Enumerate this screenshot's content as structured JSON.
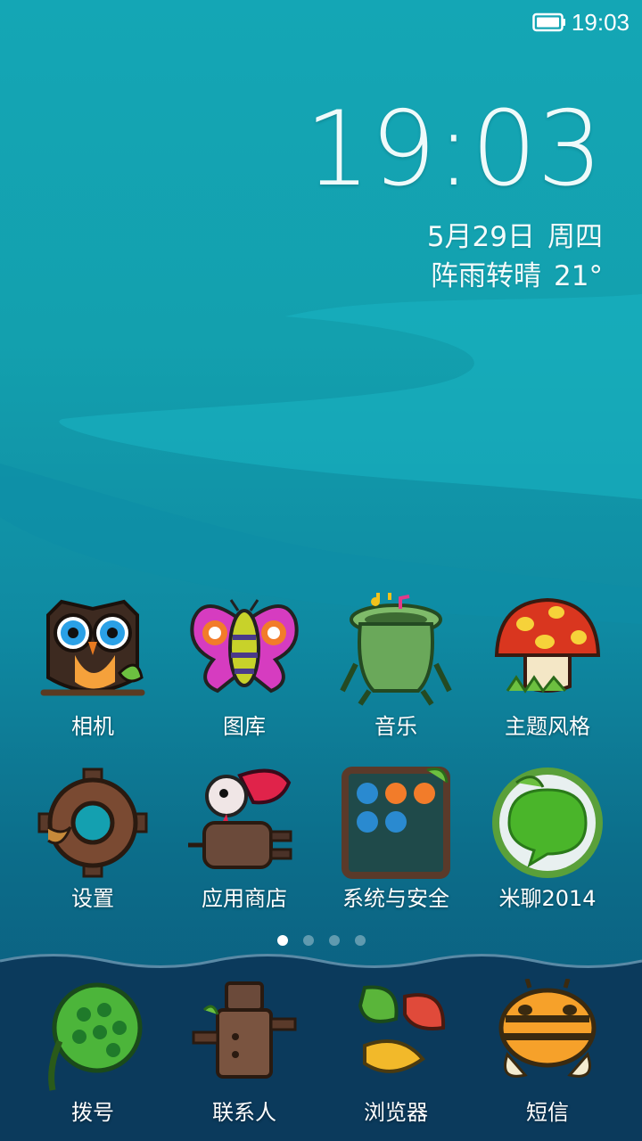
{
  "status_bar": {
    "time": "19:03",
    "battery_icon": "battery-icon"
  },
  "clock": {
    "time": "19:03",
    "date": "5月29日",
    "weekday": "周四",
    "weather": "阵雨转晴",
    "temperature": "21°"
  },
  "apps_row1": [
    {
      "label": "相机",
      "icon": "owl-camera-icon"
    },
    {
      "label": "图库",
      "icon": "butterfly-gallery-icon"
    },
    {
      "label": "音乐",
      "icon": "frog-music-icon"
    },
    {
      "label": "主题风格",
      "icon": "mushroom-theme-icon"
    }
  ],
  "apps_row2": [
    {
      "label": "设置",
      "icon": "gear-settings-icon"
    },
    {
      "label": "应用商店",
      "icon": "bird-plug-store-icon"
    },
    {
      "label": "系统与安全",
      "icon": "folder-system-icon"
    },
    {
      "label": "米聊2014",
      "icon": "miliao-icon"
    }
  ],
  "dock": [
    {
      "label": "拨号",
      "icon": "lotus-dialer-icon"
    },
    {
      "label": "联系人",
      "icon": "robot-contacts-icon"
    },
    {
      "label": "浏览器",
      "icon": "leaves-browser-icon"
    },
    {
      "label": "短信",
      "icon": "bee-sms-icon"
    }
  ],
  "page_indicator": {
    "pages": 4,
    "current": 1
  },
  "colors": {
    "background_top": "#14a6b5",
    "background_bottom": "#0a5478",
    "dock": "#0a3a5a"
  }
}
